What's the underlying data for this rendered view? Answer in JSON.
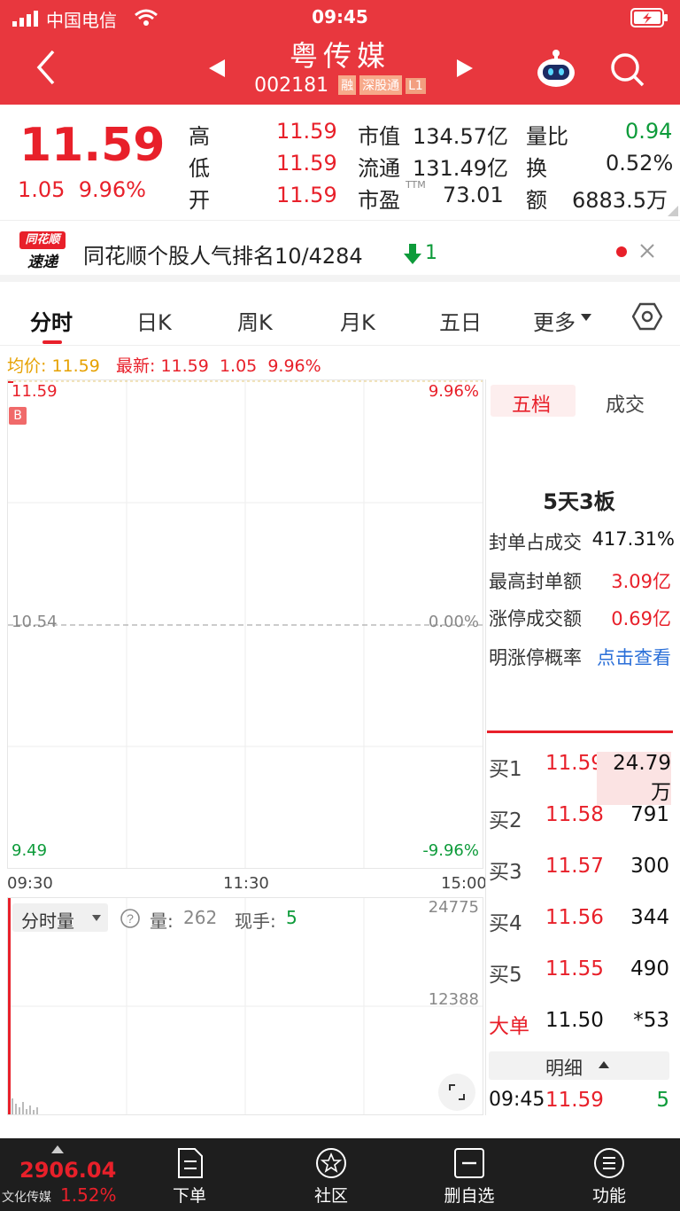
{
  "status": {
    "carrier": "中国电信",
    "time": "09:45"
  },
  "header": {
    "title": "粤传媒",
    "code": "002181",
    "tags": [
      "融",
      "深股通",
      "L1"
    ]
  },
  "quote": {
    "price": "11.59",
    "change": "1.05",
    "change_pct": "9.96%",
    "high_label": "高",
    "high": "11.59",
    "low_label": "低",
    "low": "11.59",
    "open_label": "开",
    "open": "11.59",
    "mcap_label": "市值",
    "mcap": "134.57亿",
    "float_label": "流通",
    "float": "131.49亿",
    "pe_label": "市盈",
    "pe_sup": "TTM",
    "pe": "73.01",
    "volratio_label": "量比",
    "volratio": "0.94",
    "turnover_label": "换",
    "turnover": "0.52%",
    "amount_label": "额",
    "amount": "6883.5万"
  },
  "banner": {
    "logo_top": "同花顺",
    "logo_bottom": "速递",
    "text": "同花顺个股人气排名10/4284",
    "rank_change": "1"
  },
  "tabs": [
    "分时",
    "日K",
    "周K",
    "月K",
    "五日",
    "更多"
  ],
  "chart": {
    "avg_label": "均价:",
    "avg": "11.59",
    "latest_label": "最新:",
    "latest": "11.59",
    "latest_chg": "1.05",
    "latest_pct": "9.96%",
    "y_top": "11.59",
    "y_mid": "10.54",
    "y_bottom": "9.49",
    "pct_top": "9.96%",
    "pct_mid": "0.00%",
    "pct_bottom": "-9.96%",
    "marker": "B",
    "t_start": "09:30",
    "t_mid": "11:30",
    "t_end": "15:00",
    "vol_selector": "分时量",
    "vol_label": "量:",
    "vol_value": "262",
    "hand_label": "现手:",
    "hand_value": "5",
    "vol_top": "24775",
    "vol_mid": "12388"
  },
  "panel": {
    "tab_active": "五档",
    "tab_other": "成交",
    "streak": "5天3板",
    "rows": [
      {
        "label": "封单占成交",
        "value": "417.31%"
      },
      {
        "label": "最高封单额",
        "value": "3.09亿"
      },
      {
        "label": "涨停成交额",
        "value": "0.69亿"
      },
      {
        "label": "明涨停概率",
        "value": "点击查看"
      }
    ],
    "book": [
      {
        "label": "买1",
        "price": "11.59",
        "vol": "24.79万"
      },
      {
        "label": "买2",
        "price": "11.58",
        "vol": "791"
      },
      {
        "label": "买3",
        "price": "11.57",
        "vol": "300"
      },
      {
        "label": "买4",
        "price": "11.56",
        "vol": "344"
      },
      {
        "label": "买5",
        "price": "11.55",
        "vol": "490"
      }
    ],
    "big_label": "大单",
    "big_price": "11.50",
    "big_vol": "*53",
    "detail_label": "明细",
    "trade_time": "09:45",
    "trade_price": "11.59",
    "trade_vol": "5"
  },
  "bottom": {
    "index_value": "2906.04",
    "index_name": "文化传媒",
    "index_pct": "1.52%",
    "nav": [
      "下单",
      "社区",
      "删自选",
      "功能"
    ]
  },
  "colors": {
    "header": "#e8373e",
    "up": "#e8202a",
    "down": "#0d9b3a",
    "link": "#2a6fd8"
  }
}
